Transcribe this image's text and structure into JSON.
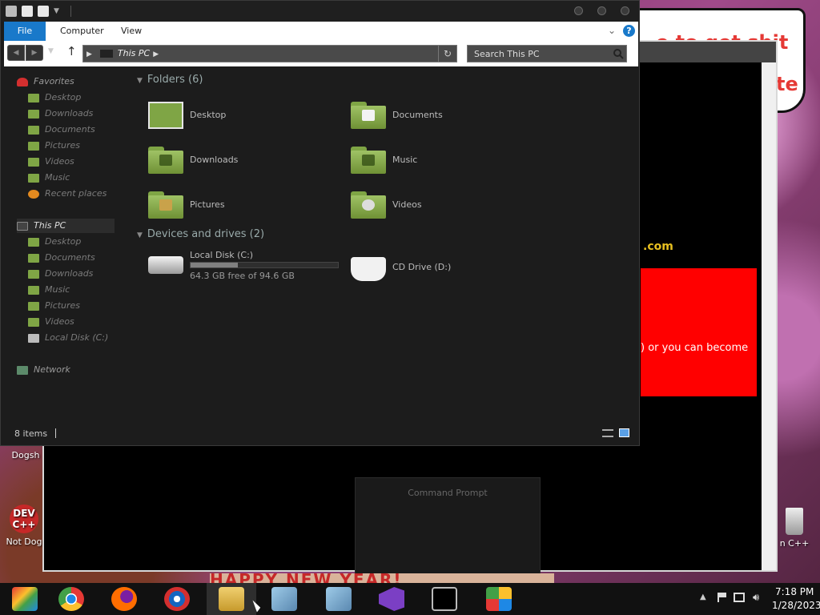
{
  "desktop": {
    "icons": [
      {
        "label": "Dogsh"
      },
      {
        "label": "Not Dog"
      },
      {
        "label": "n C++"
      }
    ],
    "dev_logo": "DEV C++"
  },
  "background_window": {
    "domain_text": ".com",
    "red_text": ") or you can become",
    "dialog_title": "Command Prompt",
    "speech_text_1": "e to get shit",
    "speech_text_2": "te",
    "banner_text": "HAPPY NEW YEAR!"
  },
  "explorer": {
    "ribbon": {
      "file": "File",
      "computer": "Computer",
      "view": "View",
      "help": "?"
    },
    "address": {
      "location": "This PC"
    },
    "search": {
      "placeholder": "Search This PC"
    },
    "nav": {
      "favorites": "Favorites",
      "favorites_items": [
        "Desktop",
        "Downloads",
        "Documents",
        "Pictures",
        "Videos",
        "Music",
        "Recent places"
      ],
      "this_pc": "This PC",
      "this_pc_items": [
        "Desktop",
        "Documents",
        "Downloads",
        "Music",
        "Pictures",
        "Videos",
        "Local Disk (C:)"
      ],
      "network": "Network"
    },
    "folders_header": "Folders (6)",
    "folders": [
      "Desktop",
      "Documents",
      "Downloads",
      "Music",
      "Pictures",
      "Videos"
    ],
    "devices_header": "Devices and drives (2)",
    "drives": {
      "c_name": "Local Disk (C:)",
      "c_free": "64.3 GB free of 94.6 GB",
      "c_used_fraction": 0.32,
      "d_name": "CD Drive (D:)"
    },
    "status": "8 items"
  },
  "taskbar": {
    "apps": [
      "chrome-remote",
      "chrome",
      "firefox",
      "edge",
      "file-explorer",
      "network-setup",
      "network-setup-2",
      "visual-studio",
      "command-prompt",
      "control-panel"
    ],
    "time": "7:18 PM",
    "date": "1/28/2023"
  }
}
